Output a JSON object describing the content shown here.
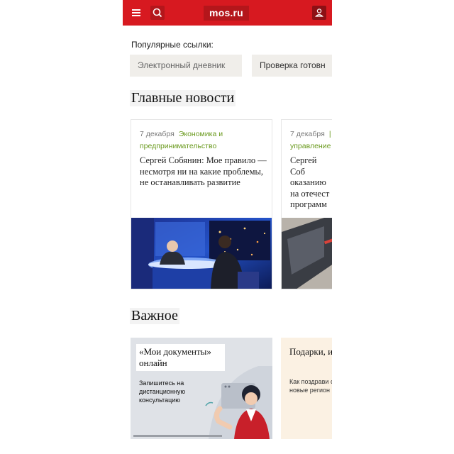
{
  "header": {
    "logo": "mos.ru",
    "menu_icon": "hamburger-icon",
    "search_icon": "search-icon",
    "user_icon": "user-icon",
    "brand_color": "#d71920"
  },
  "popular": {
    "label": "Популярные ссылки:",
    "links": [
      "Электронный дневник",
      "Проверка готовн"
    ]
  },
  "main_news": {
    "title": "Главные новости",
    "cards": [
      {
        "date": "7 декабря",
        "category": "Экономика и предпринимательство",
        "headline": "Сергей Собянин: Мое правило — несмотря ни на какие проблемы, не останавливать развитие"
      },
      {
        "date": "7 декабря",
        "category": "управление",
        "headline": "Сергей Соб оказанию на отечест программ"
      }
    ]
  },
  "important": {
    "title": "Важное",
    "cards": [
      {
        "title": "«Мои документы» онлайн",
        "subtitle": "Запишитесь на дистанционную консультацию"
      },
      {
        "title": "Подарки, и помощ",
        "subtitle": "Как поздрави с Новым годо новые регион и участников"
      }
    ]
  }
}
